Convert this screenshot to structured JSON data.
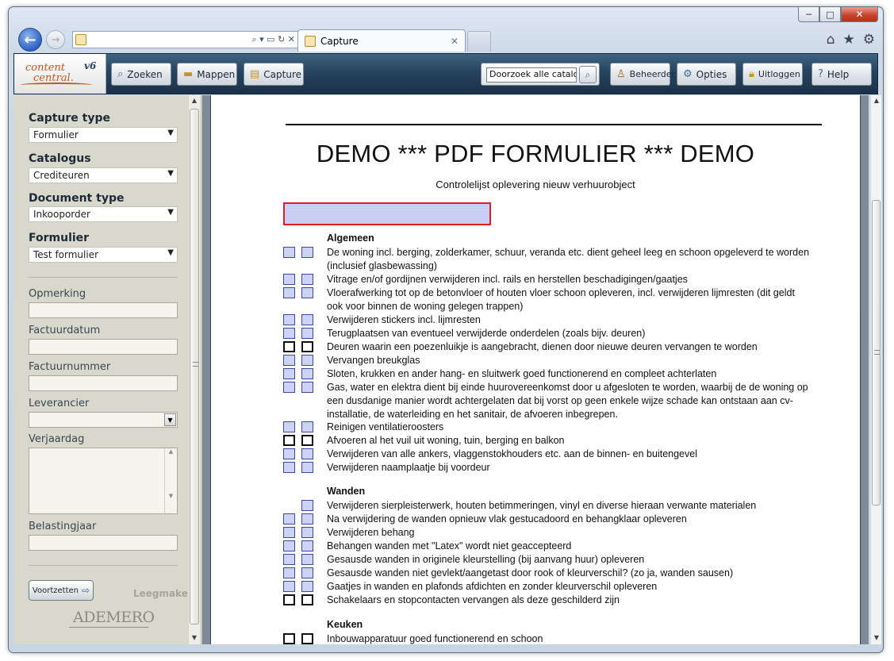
{
  "browser": {
    "window_controls": [
      "─",
      "□",
      "✕"
    ],
    "address_icons": "⌕ ▾ ▭ ↻ ✕",
    "tab_title": "Capture",
    "tab_close": "✕",
    "right_icons": [
      "⌂",
      "★",
      "⚙"
    ]
  },
  "app": {
    "logo_line1": "content",
    "logo_line2": "central.",
    "logo_version": "v6",
    "toolbar": {
      "search_label": "Zoeken",
      "folders_label": "Mappen",
      "capture_label": "Capture",
      "catalog_search_value": "Doorzoek alle catalogi",
      "admin_label": "Beheerder",
      "options_label": "Opties",
      "logout_label": "Uitloggen",
      "help_label": "Help"
    }
  },
  "sidebar": {
    "capture_type_label": "Capture type",
    "capture_type_value": "Formulier",
    "catalog_label": "Catalogus",
    "catalog_value": "Crediteuren",
    "doc_type_label": "Document type",
    "doc_type_value": "Inkooporder",
    "form_label": "Formulier",
    "form_value": "Test formulier",
    "fields": {
      "opmerking": "Opmerking",
      "factuurdatum": "Factuurdatum",
      "factuurnummer": "Factuurnummer",
      "leverancier": "Leverancier",
      "verjaardag": "Verjaardag",
      "belastingjaar": "Belastingjaar"
    },
    "continue_label": "Voortzetten",
    "clear_label": "Leegmaken",
    "footer_logo": "ADEMERO"
  },
  "document": {
    "title": "DEMO *** PDF FORMULIER *** DEMO",
    "subtitle": "Controlelijst oplevering nieuw verhuurobject",
    "sections": [
      {
        "title": "Algemeen",
        "items": [
          "De woning incl. berging, zolderkamer, schuur, veranda etc. dient geheel leeg en schoon opgeleverd te worden (inclusief glasbewassing)",
          "Vitrage en/of gordijnen verwijderen incl. rails en herstellen beschadigingen/gaatjes",
          "Vloerafwerking tot op de betonvloer of houten vloer schoon opleveren, incl. verwijderen lijmresten (dit geldt ook voor binnen de woning gelegen trappen)",
          "Verwijderen stickers incl. lijmresten",
          "Terugplaatsen van eventueel verwijderde onderdelen (zoals bijv. deuren)",
          "Deuren waarin een poezenluikje is aangebracht, dienen door nieuwe deuren vervangen te worden",
          "Vervangen breukglas",
          "Sloten, krukken en ander hang- en sluitwerk goed functionerend en compleet achterlaten",
          "Gas, water en elektra dient bij einde huurovereenkomst door u afgesloten te worden, waarbij de de woning op een dusdanige manier wordt achtergelaten dat bij vorst op geen enkele wijze schade kan ontstaan aan cv-installatie, de waterleiding en het sanitair, de afvoeren inbegrepen.",
          "Reinigen ventilatieroosters",
          "Afvoeren al het vuil uit woning, tuin, berging en balkon",
          "Verwijderen van alle ankers, vlaggenstokhouders etc. aan de binnen- en buitengevel",
          "Verwijderen naamplaatje bij voordeur"
        ]
      },
      {
        "title": "Wanden",
        "items": [
          "Verwijderen sierpleisterwerk, houten betimmeringen, vinyl en diverse hieraan verwante materialen",
          "Na verwijdering de wanden opnieuw vlak gestucadoord en behangklaar opleveren",
          "Verwijderen behang",
          "Behangen wanden met \"Latex\" wordt niet geaccepteerd",
          "Gesausde wanden in originele kleurstelling (bij aanvang huur) opleveren",
          "Gesausde wanden niet gevlekt/aangetast door rook of kleurverschil? (zo ja, wanden sausen)",
          "Gaatjes in wanden en plafonds afdichten en zonder kleurverschil opleveren",
          "Schakelaars en stopcontacten vervangen als deze geschilderd zijn"
        ]
      },
      {
        "title": "Keuken",
        "items": [
          "Inbouwapparatuur goed functionerend en schoon"
        ]
      }
    ]
  }
}
